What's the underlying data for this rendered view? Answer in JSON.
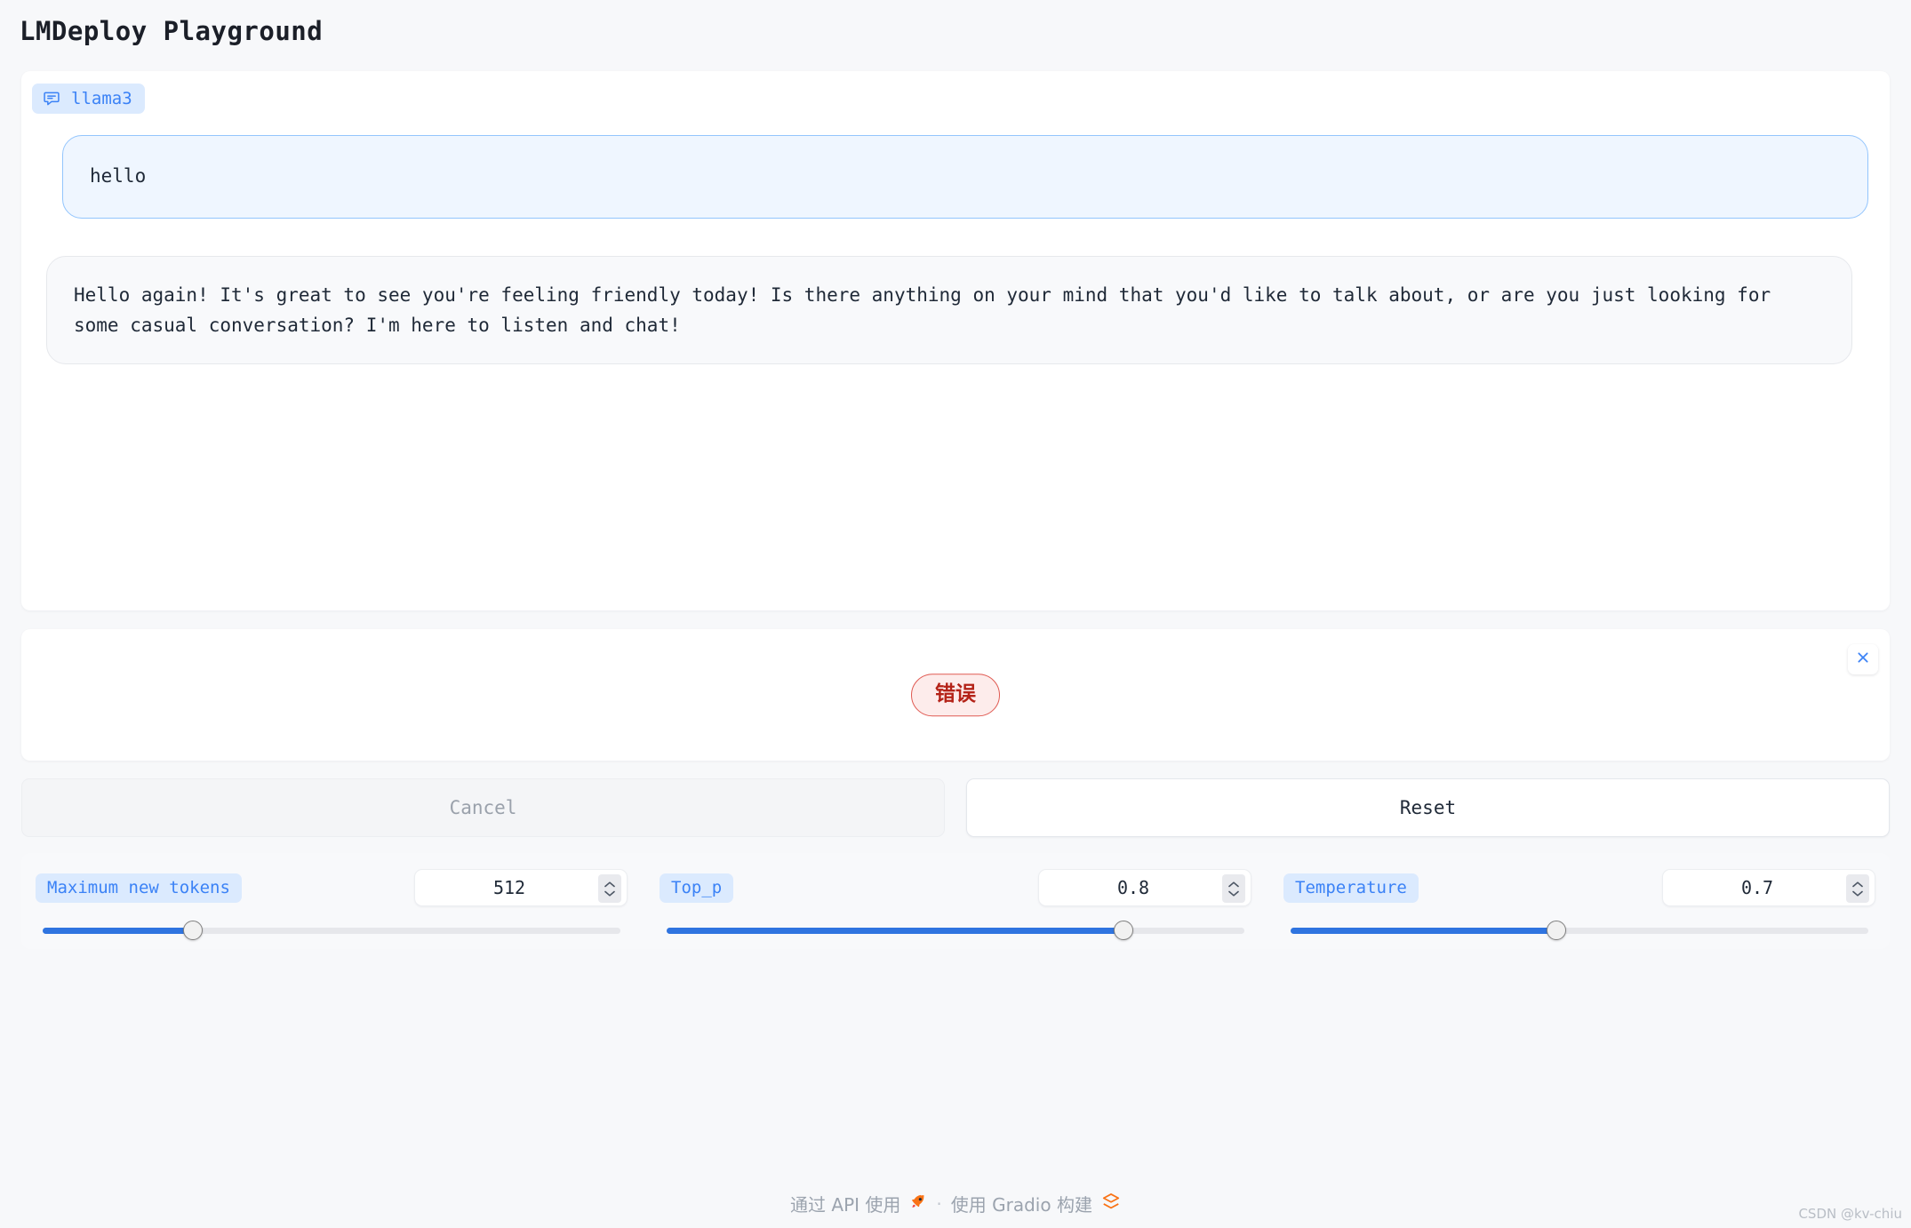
{
  "app": {
    "title": "LMDeploy Playground"
  },
  "chat": {
    "label": "llama3",
    "label_icon": "chat-bubble-icon",
    "messages": [
      {
        "role": "user",
        "text": "hello"
      },
      {
        "role": "assistant",
        "text": "Hello again! It's great to see you're feeling friendly today! Is there anything on your mind that you'd like to talk about, or are you just looking for some casual conversation? I'm here to listen and chat!"
      }
    ]
  },
  "error_panel": {
    "badge": "错误",
    "close_icon": "close-icon",
    "badge_color": "#b42318",
    "badge_bg": "#fdeceb",
    "badge_border": "#e05a52"
  },
  "actions": {
    "cancel_label": "Cancel",
    "reset_label": "Reset"
  },
  "controls": [
    {
      "label": "Maximum new tokens",
      "value": "512",
      "fill_percent": 26
    },
    {
      "label": "Top_p",
      "value": "0.8",
      "fill_percent": 79
    },
    {
      "label": "Temperature",
      "value": "0.7",
      "fill_percent": 46
    }
  ],
  "footer": {
    "via_api": "通过 API 使用",
    "rocket_icon": "rocket-icon",
    "separator": "·",
    "built_with": "使用 Gradio 构建",
    "gradio_icon": "gradio-logo-icon"
  },
  "watermark": "CSDN @kv-chiu",
  "theme": {
    "accent": "#3b82f6",
    "slider_fill": "#2f74e0",
    "label_bg": "#dbeafe",
    "page_bg": "#f7f8fa",
    "user_bubble_bg": "#eff6ff",
    "user_bubble_border": "#93c5fd",
    "bot_bubble_bg": "#f8f9fb"
  }
}
